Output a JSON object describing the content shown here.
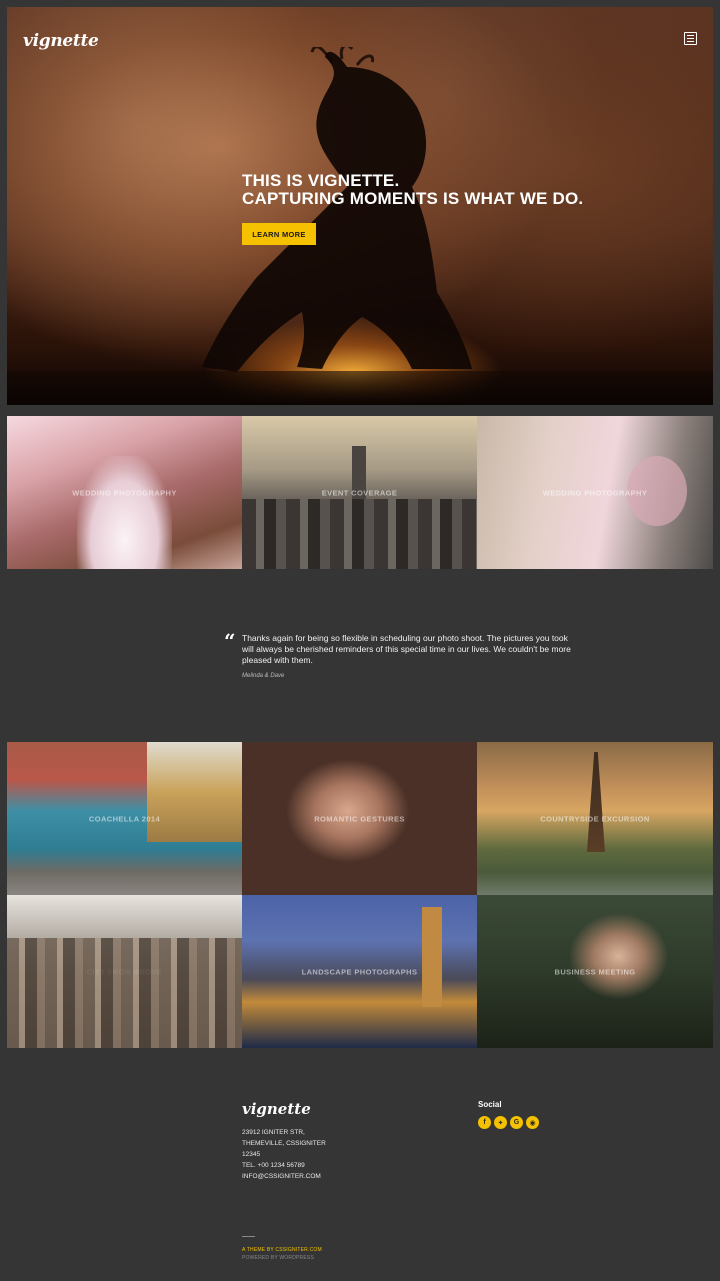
{
  "header": {
    "logo": "vignette",
    "menu_icon": "menu-icon"
  },
  "hero": {
    "title_line1": "THIS IS VIGNETTE.",
    "title_line2": "CAPTURING MOMENTS IS WHAT WE DO.",
    "cta_label": "LEARN MORE"
  },
  "gallery_top": [
    {
      "caption": "WEDDING PHOTOGRAPHY"
    },
    {
      "caption": "EVENT COVERAGE"
    },
    {
      "caption": "WEDDING PHOTOGRAPHY"
    }
  ],
  "testimonial": {
    "text": "Thanks again for being so flexible in scheduling our photo shoot.  The pictures you took will always be cherished reminders of this special time in our lives.  We couldn't be more pleased with them.",
    "author": "Melinda & Dave"
  },
  "gallery_bottom": [
    {
      "caption": "COACHELLA 2014"
    },
    {
      "caption": "ROMANTIC GESTURES"
    },
    {
      "caption": "COUNTRYSIDE EXCURSION"
    },
    {
      "caption": "CITY FROM ABOVE"
    },
    {
      "caption": "LANDSCAPE PHOTOGRAPHS"
    },
    {
      "caption": "BUSINESS MEETING"
    }
  ],
  "footer": {
    "logo": "vignette",
    "address": [
      "23912 IGNITER STR,",
      "THEMEVILLE, CSSIGNITER",
      "12345",
      "TEL. +00 1234 56789",
      "INFO@CSSIGNITER.COM"
    ],
    "social_title": "Social",
    "social_icons": [
      "facebook-icon",
      "twitter-icon",
      "google-icon",
      "instagram-icon"
    ],
    "credit": "A THEME BY CSSIGNITER.COM",
    "powered": "POWERED BY WORDPRESS"
  },
  "colors": {
    "accent": "#f5c100",
    "background": "#353535"
  }
}
